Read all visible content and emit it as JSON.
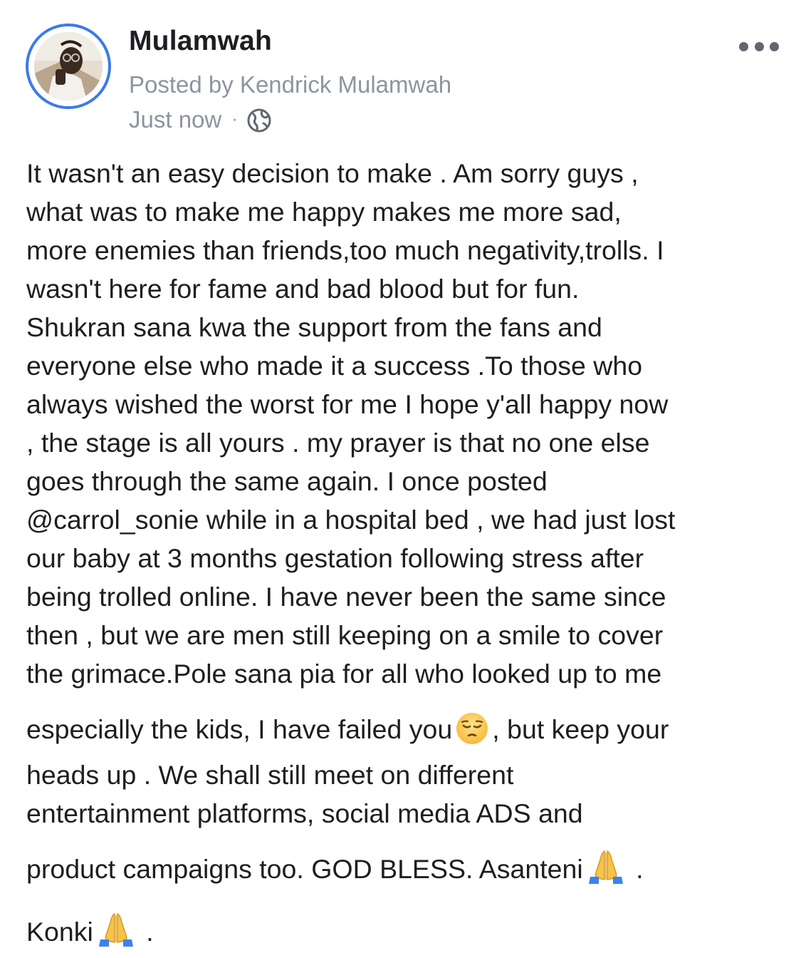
{
  "post": {
    "page_name": "Mulamwah",
    "posted_by": "Posted by Kendrick Mulamwah",
    "timestamp": "Just now",
    "separator": "·",
    "privacy_icon": "globe-icon",
    "more_icon": "more-options-icon",
    "avatar_ring_color": "#3b7be8",
    "body": {
      "part1": "It wasn't an easy decision to make . Am sorry guys ,\nwhat was to make me happy makes me more sad,\nmore enemies than friends,too much negativity,trolls. I\nwasn't here for fame and bad blood but for fun.\nShukran sana kwa the support from the fans and\neveryone else who made it a success .To those who\nalways wished the worst for me I hope y'all happy now\n, the stage is all yours . my prayer is that no one else\ngoes through the same again. I once posted\n@carrol_sonie while in a hospital bed , we had just lost\nour baby at 3 months gestation  following stress after\nbeing trolled online.  I have never been the same since\nthen , but we are men still keeping on a smile to cover\nthe grimace.Pole sana pia for all who looked up to me\n",
      "part2": "especially the kids, I have failed you",
      "emoji1": "pensive-face-emoji",
      "part3": ", but keep your\nheads up . We shall still meet on different\nentertainment platforms, social media ADS and\n",
      "part4": "product campaigns too. GOD BLESS. Asanteni",
      "emoji2": "folded-hands-emoji",
      "part5": " .\n",
      "part6": "Konki",
      "emoji3": "folded-hands-emoji",
      "part7": " ."
    }
  }
}
